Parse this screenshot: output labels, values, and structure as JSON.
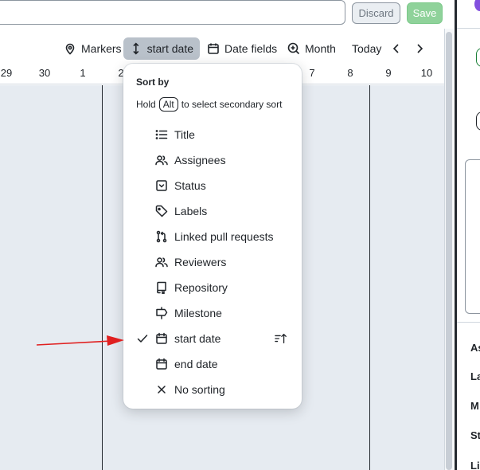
{
  "top_bar": {
    "discard_label": "Discard",
    "save_label": "Save"
  },
  "toolbar": {
    "markers_label": "Markers",
    "sort_label": "start date",
    "date_fields_label": "Date fields",
    "zoom_label": "Month",
    "today_label": "Today"
  },
  "dates": [
    "29",
    "30",
    "1",
    "2",
    "7",
    "8",
    "9",
    "10"
  ],
  "sort_menu": {
    "title": "Sort by",
    "hint_before": "Hold",
    "hint_key": "Alt",
    "hint_after": "to select secondary sort",
    "items": [
      {
        "label": "Title",
        "icon": "list-icon",
        "selected": false
      },
      {
        "label": "Assignees",
        "icon": "people-icon",
        "selected": false
      },
      {
        "label": "Status",
        "icon": "single-select-icon",
        "selected": false
      },
      {
        "label": "Labels",
        "icon": "tag-icon",
        "selected": false
      },
      {
        "label": "Linked pull requests",
        "icon": "git-pull-request-icon",
        "selected": false
      },
      {
        "label": "Reviewers",
        "icon": "people-icon",
        "selected": false
      },
      {
        "label": "Repository",
        "icon": "repo-icon",
        "selected": false
      },
      {
        "label": "Milestone",
        "icon": "milestone-icon",
        "selected": false
      },
      {
        "label": "start date",
        "icon": "calendar-icon",
        "selected": true
      },
      {
        "label": "end date",
        "icon": "calendar-icon",
        "selected": false
      },
      {
        "label": "No sorting",
        "icon": "x-icon",
        "selected": false
      }
    ]
  },
  "right_panel": {
    "fragments": [
      "As",
      "La",
      "M",
      "St",
      "Li"
    ]
  },
  "colors": {
    "accent_save": "#8fd29a",
    "annotation_arrow": "#e02020",
    "timeline_bg": "#e6ebf1"
  }
}
